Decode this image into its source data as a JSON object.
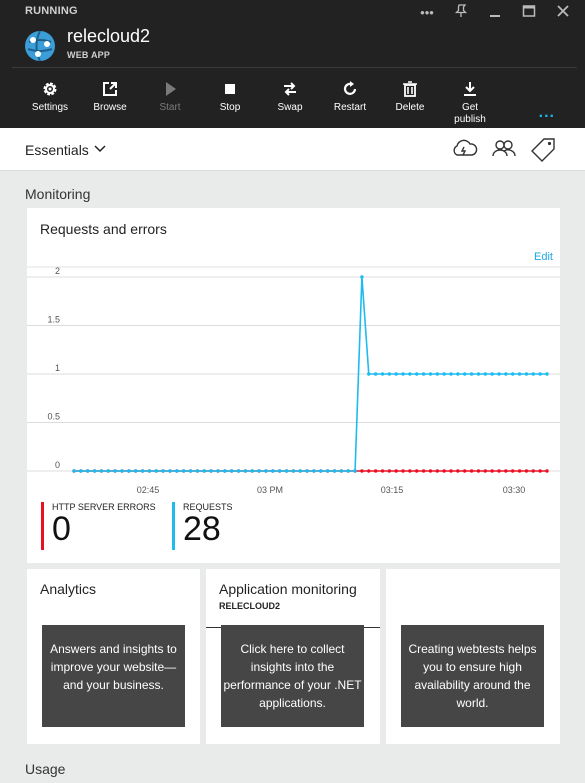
{
  "header": {
    "status": "RUNNING",
    "app_name": "relecloud2",
    "app_type": "WEB APP",
    "window_controls": [
      "more-icon",
      "pin-icon",
      "minimize-icon",
      "maximize-icon",
      "close-icon"
    ]
  },
  "toolbar": {
    "items": [
      {
        "label": "Settings",
        "icon": "gear-icon",
        "enabled": true
      },
      {
        "label": "Browse",
        "icon": "external-link-icon",
        "enabled": true
      },
      {
        "label": "Start",
        "icon": "play-icon",
        "enabled": false
      },
      {
        "label": "Stop",
        "icon": "stop-icon",
        "enabled": true
      },
      {
        "label": "Swap",
        "icon": "swap-icon",
        "enabled": true
      },
      {
        "label": "Restart",
        "icon": "restart-icon",
        "enabled": true
      },
      {
        "label": "Delete",
        "icon": "trash-icon",
        "enabled": true
      },
      {
        "label": "Get publish ...",
        "icon": "download-icon",
        "enabled": true
      }
    ],
    "more": "..."
  },
  "essentials": {
    "label": "Essentials",
    "icons": [
      "cloud-icon",
      "users-icon",
      "tag-icon"
    ]
  },
  "monitoring": {
    "title": "Monitoring",
    "chart_title": "Requests and errors",
    "edit_label": "Edit",
    "stats": [
      {
        "label": "HTTP SERVER ERRORS",
        "value": "0",
        "color": "#e81123"
      },
      {
        "label": "REQUESTS",
        "value": "28",
        "color": "#1ebbee"
      }
    ]
  },
  "chart_data": {
    "type": "line",
    "ylim": [
      0,
      2
    ],
    "y_ticks": [
      "0",
      "0.5",
      "1",
      "1.5",
      "2"
    ],
    "x_ticks": [
      "02:45",
      "03 PM",
      "03:15",
      "03:30"
    ],
    "grid": true,
    "series": [
      {
        "name": "REQUESTS",
        "color": "#1ebbee",
        "values": [
          0,
          0,
          0,
          0,
          0,
          0,
          0,
          0,
          0,
          0,
          0,
          0,
          0,
          0,
          0,
          0,
          0,
          0,
          0,
          0,
          0,
          0,
          0,
          0,
          0,
          0,
          0,
          0,
          0,
          0,
          0,
          0,
          0,
          0,
          0,
          0,
          0,
          0,
          0,
          0,
          0,
          0,
          2,
          1,
          1,
          1,
          1,
          1,
          1,
          1,
          1,
          1,
          1,
          1,
          1,
          1,
          1,
          1,
          1,
          1,
          1,
          1,
          1,
          1,
          1,
          1,
          1,
          1,
          1,
          1
        ]
      },
      {
        "name": "HTTP SERVER ERRORS",
        "color": "#e81123",
        "values": [
          0,
          0,
          0,
          0,
          0,
          0,
          0,
          0,
          0,
          0,
          0,
          0,
          0,
          0,
          0,
          0,
          0,
          0,
          0,
          0,
          0,
          0,
          0,
          0,
          0,
          0,
          0,
          0,
          0,
          0,
          0,
          0,
          0,
          0,
          0,
          0,
          0,
          0,
          0,
          0,
          0,
          0,
          0,
          0,
          0,
          0,
          0,
          0,
          0,
          0,
          0,
          0,
          0,
          0,
          0,
          0,
          0,
          0,
          0,
          0,
          0,
          0,
          0,
          0,
          0,
          0,
          0,
          0,
          0,
          0
        ]
      }
    ]
  },
  "tiles": [
    {
      "title": "Analytics",
      "subtitle": "",
      "overlay": "Answers and insights to improve your website—and your business."
    },
    {
      "title": "Application monitoring",
      "subtitle": "RELECLOUD2",
      "overlay": "Click here to collect insights into the performance of your .NET applications."
    },
    {
      "title": "",
      "subtitle": "",
      "overlay": "Creating webtests helps you to ensure high availability around the world."
    }
  ],
  "usage": {
    "title": "Usage"
  }
}
